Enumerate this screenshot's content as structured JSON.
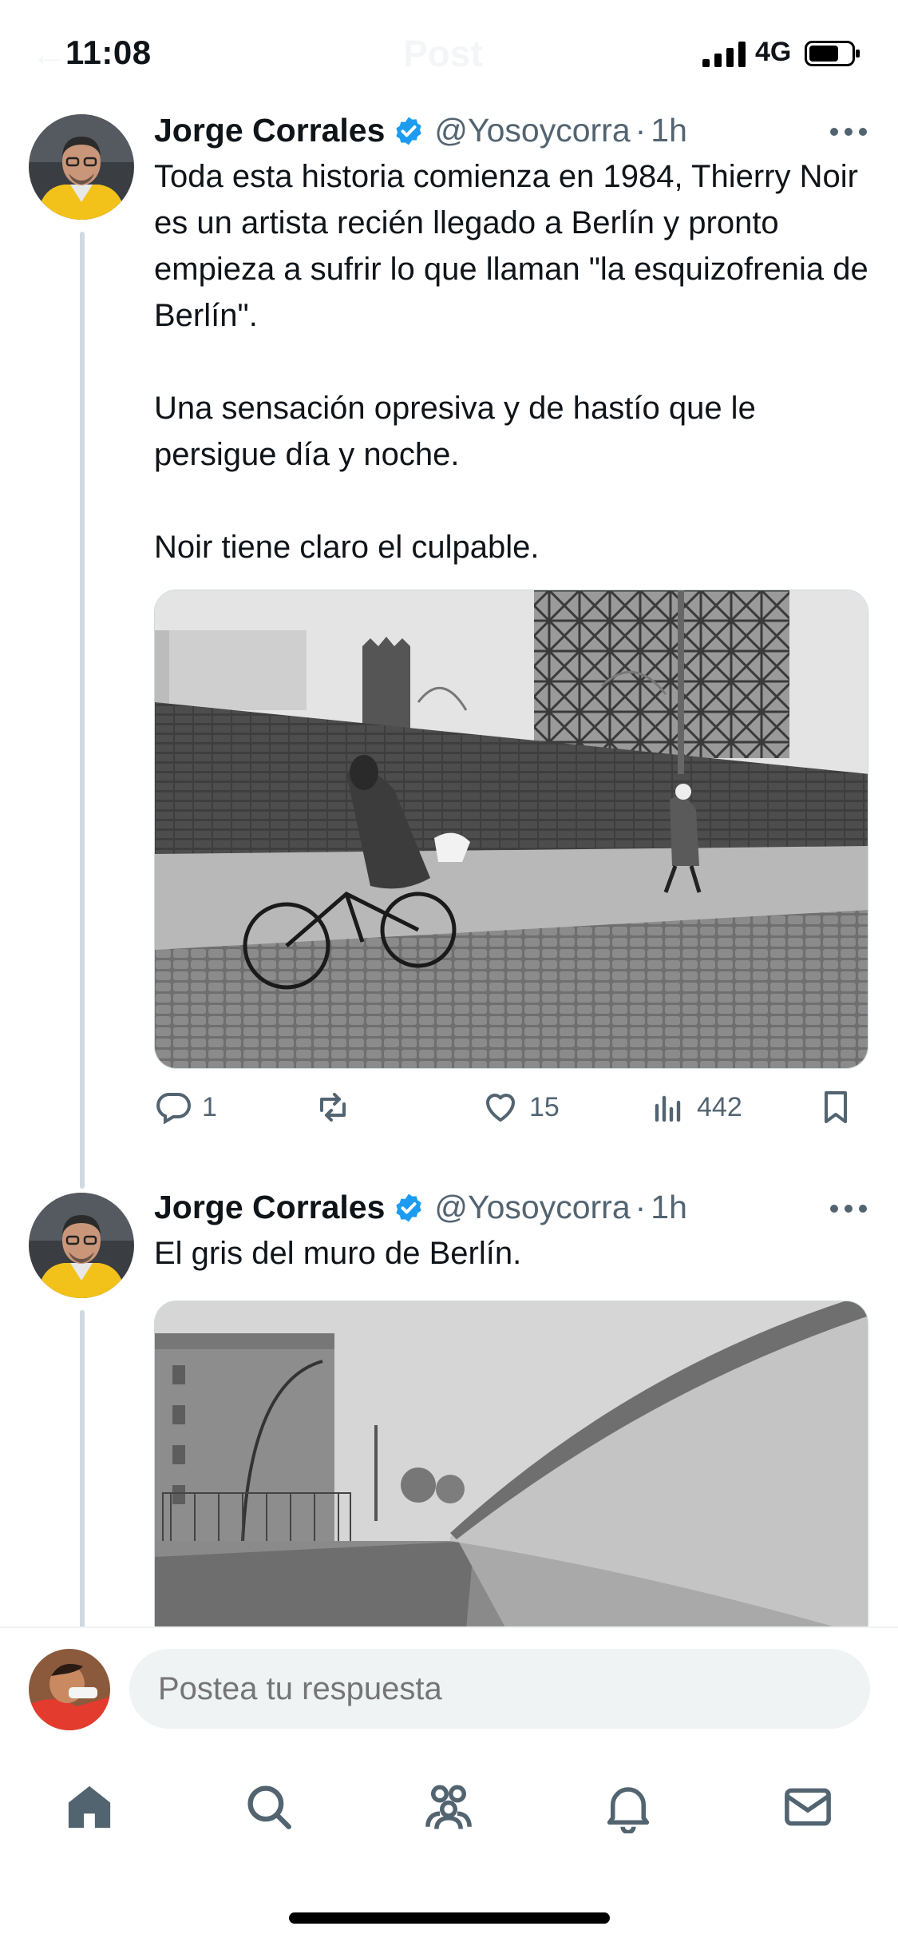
{
  "status_bar": {
    "time": "11:08",
    "network": "4G",
    "header_title_ghost": "Post"
  },
  "thread": [
    {
      "author": "Jorge Corrales",
      "handle": "@Yosoycorra",
      "separator": "·",
      "time": "1h",
      "paragraphs": [
        "Toda esta historia comienza en 1984, Thierry Noir es un artista recién llegado a Berlín y pronto empieza a sufrir lo que llaman \"la esquizofrenia de Berlín\".",
        "Una sensación opresiva y de hastío que le persigue día y noche.",
        "Noir tiene claro el culpable."
      ],
      "actions": {
        "replies": "1",
        "retweets": "",
        "likes": "15",
        "views": "442"
      }
    },
    {
      "author": "Jorge Corrales",
      "handle": "@Yosoycorra",
      "separator": "·",
      "time": "1h",
      "paragraphs": [
        "El gris del muro de Berlín."
      ]
    }
  ],
  "reply": {
    "placeholder": "Postea tu respuesta"
  },
  "colors": {
    "accent": "#1d9bf0",
    "secondary_text": "#536471",
    "thread_line": "#cfd9de",
    "input_bg": "#eff3f4"
  },
  "icons": [
    "back-icon",
    "signal-icon",
    "battery-icon",
    "verified-badge-icon",
    "more-icon",
    "reply-icon",
    "retweet-icon",
    "like-icon",
    "views-icon",
    "bookmark-icon",
    "home-icon",
    "search-icon",
    "communities-icon",
    "notifications-icon",
    "messages-icon"
  ]
}
